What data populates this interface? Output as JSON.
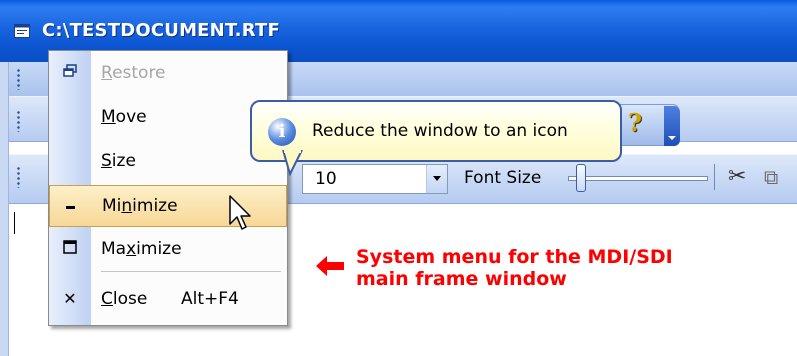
{
  "window": {
    "title": "C:\\TESTDOCUMENT.RTF",
    "titlebar_color": "#0c54d0"
  },
  "toolbar": {
    "font_size_value": "10",
    "font_size_label": "Font Size",
    "help_icon": "help-question-icon",
    "cut_icon": "scissors-icon",
    "copy_icon": "copy-icon"
  },
  "system_menu": {
    "items": [
      {
        "label_pre": "",
        "label_u": "R",
        "label_post": "estore",
        "accel": "",
        "icon": "restore-icon",
        "enabled": false
      },
      {
        "label_pre": "",
        "label_u": "M",
        "label_post": "ove",
        "accel": "",
        "icon": "",
        "enabled": true
      },
      {
        "label_pre": "",
        "label_u": "S",
        "label_post": "ize",
        "accel": "",
        "icon": "",
        "enabled": true
      },
      {
        "label_pre": "Mi",
        "label_u": "n",
        "label_post": "imize",
        "accel": "",
        "icon": "minimize-icon",
        "enabled": true,
        "highlighted": true
      },
      {
        "label_pre": "Ma",
        "label_u": "x",
        "label_post": "imize",
        "accel": "",
        "icon": "maximize-icon",
        "enabled": true
      },
      {
        "label_pre": "",
        "label_u": "C",
        "label_post": "lose",
        "accel": "Alt+F4",
        "icon": "close-icon",
        "enabled": true
      }
    ]
  },
  "tooltip": {
    "text": "Reduce the window to an icon",
    "icon": "info-icon"
  },
  "annotation": {
    "line1": "System menu for the MDI/SDI",
    "line2": "main frame window",
    "color": "#ff0000"
  }
}
